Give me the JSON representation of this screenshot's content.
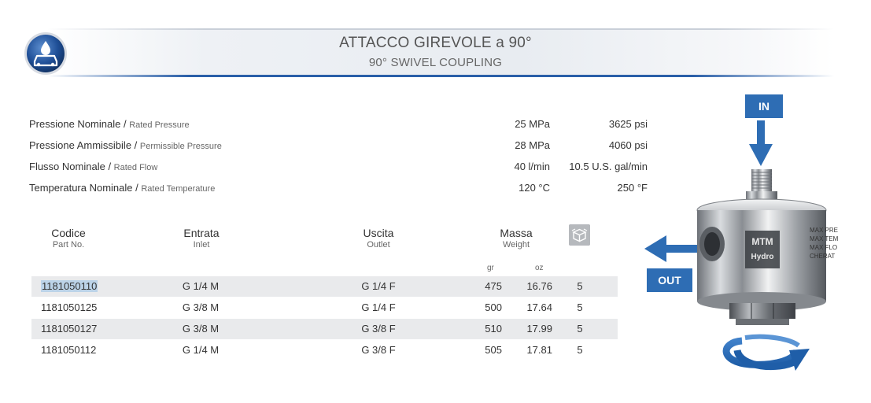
{
  "header": {
    "title": "ATTACCO GIREVOLE a 90°",
    "subtitle": "90° SWIVEL COUPLING",
    "logo_icon": "car-wash-icon",
    "accent_color": "#2a5fa8"
  },
  "specs": [
    {
      "it": "Pressione Nominale",
      "en": "Rated Pressure",
      "metric": "25 MPa",
      "imperial": "3625 psi"
    },
    {
      "it": "Pressione Ammissibile",
      "en": "Permissible Pressure",
      "metric": "28 MPa",
      "imperial": "4060 psi"
    },
    {
      "it": "Flusso Nominale",
      "en": "Rated Flow",
      "metric": "40 l/min",
      "imperial": "10.5 U.S. gal/min"
    },
    {
      "it": "Temperatura Nominale",
      "en": "Rated Temperature",
      "metric": "120 °C",
      "imperial": "250  °F"
    }
  ],
  "table": {
    "headers": {
      "code": {
        "it": "Codice",
        "en": "Part No."
      },
      "inlet": {
        "it": "Entrata",
        "en": "Inlet"
      },
      "outlet": {
        "it": "Uscita",
        "en": "Outlet"
      },
      "mass": {
        "it": "Massa",
        "en": "Weight"
      },
      "unit_gr": "gr",
      "unit_oz": "oz",
      "pack_icon": "package-icon"
    },
    "rows": [
      {
        "code": "1181050110",
        "inlet": "G 1/4 M",
        "outlet": "G 1/4 F",
        "gr": "475",
        "oz": "16.76",
        "pack": "5"
      },
      {
        "code": "1181050125",
        "inlet": "G 3/8 M",
        "outlet": "G 1/4 F",
        "gr": "500",
        "oz": "17.64",
        "pack": "5"
      },
      {
        "code": "1181050127",
        "inlet": "G 3/8 M",
        "outlet": "G 3/8 F",
        "gr": "510",
        "oz": "17.99",
        "pack": "5"
      },
      {
        "code": "1181050112",
        "inlet": "G 1/4 M",
        "outlet": "G 3/8 F",
        "gr": "505",
        "oz": "17.81",
        "pack": "5"
      }
    ]
  },
  "product": {
    "in_label": "IN",
    "out_label": "OUT",
    "brand_line1": "MTM",
    "brand_line2": "Hydro",
    "engraving": [
      "MAX PRE",
      "MAX TEM",
      "MAX FLO",
      "CHERAT"
    ],
    "rotation_icon": "rotation-arrow-icon",
    "label_color": "#2e6db4"
  }
}
